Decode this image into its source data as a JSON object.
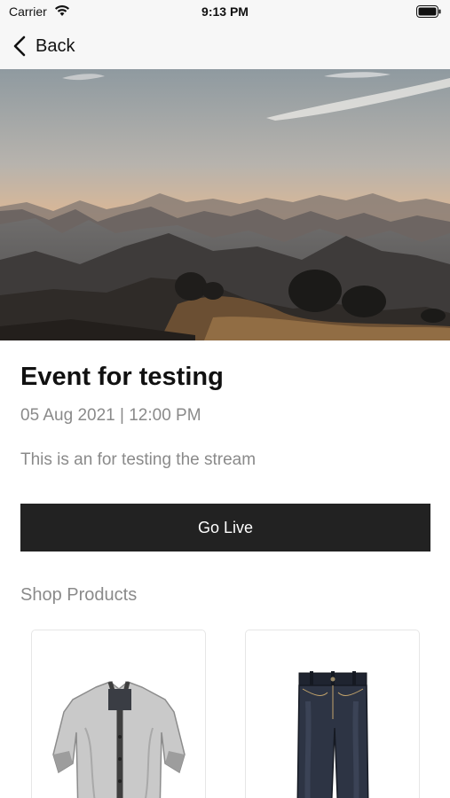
{
  "status_bar": {
    "carrier": "Carrier",
    "time": "9:13 PM",
    "icons": [
      "wifi-icon",
      "battery-icon"
    ]
  },
  "nav": {
    "back_label": "Back",
    "icon": "chevron-left-icon"
  },
  "hero": {
    "image": "mountain-sunset-image"
  },
  "event": {
    "title": "Event for testing",
    "datetime": "05 Aug 2021 | 12:00 PM",
    "description": "This is an for testing the stream"
  },
  "actions": {
    "go_live_label": "Go Live"
  },
  "shop": {
    "section_title": "Shop Products",
    "products": [
      {
        "image": "grey-cardigan-image"
      },
      {
        "image": "dark-jeans-image"
      }
    ]
  },
  "colors": {
    "button_bg": "#222222",
    "muted_text": "#8a8a8a",
    "bar_bg": "#f7f7f7"
  }
}
